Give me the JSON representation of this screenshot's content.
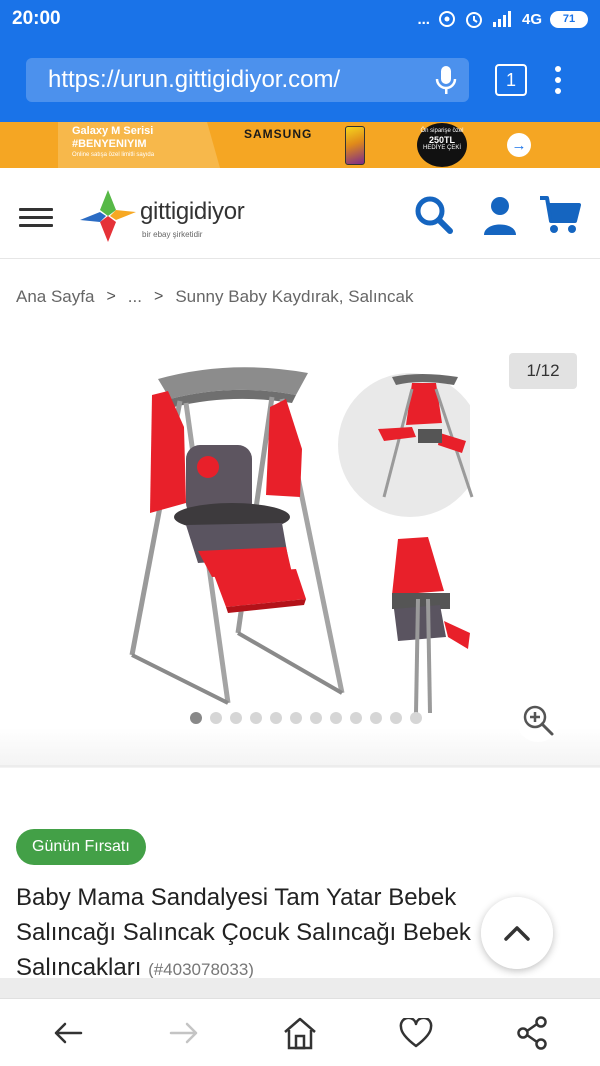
{
  "status_bar": {
    "time": "20:00",
    "dots": "...",
    "network": "4G",
    "battery": "71"
  },
  "browser": {
    "url": "https://urun.gittigidiyor.com/",
    "tab_count": "1"
  },
  "ad_banner": {
    "line1": "Galaxy M Serisi",
    "line2": "#BENYENIYIM",
    "line3": "Online satışa özel limitli sayıda",
    "brand": "SAMSUNG",
    "badge_top": "Ön siparişe özel",
    "badge_amount": "250TL",
    "badge_bottom": "HEDİYE ÇEKİ"
  },
  "site_header": {
    "logo_text": "gittigidiyor",
    "logo_sub": "bir ebay şirketidir"
  },
  "breadcrumb": {
    "items": [
      "Ana Sayfa",
      "...",
      "Sunny Baby Kaydırak, Salıncak"
    ]
  },
  "gallery": {
    "page_indicator": "1/12",
    "total_dots": 12,
    "active_dot": 1
  },
  "product": {
    "deal_badge": "Günün Fırsatı",
    "title": "Baby Mama Sandalyesi Tam Yatar Bebek Salıncağı Salıncak Çocuk Salıncağı Bebek Salıncakları",
    "code": "(#403078033)"
  },
  "colors": {
    "browser_blue": "#1a73e8",
    "ad_orange": "#f5a623",
    "brand_blue": "#1565c0",
    "deal_green": "#43a047",
    "product_red": "#e8202a"
  },
  "icons": {
    "header": [
      "search-icon",
      "user-icon",
      "cart-icon"
    ],
    "bottom_nav": [
      "back-arrow-icon",
      "forward-arrow-icon",
      "home-icon",
      "heart-icon",
      "share-icon"
    ]
  }
}
